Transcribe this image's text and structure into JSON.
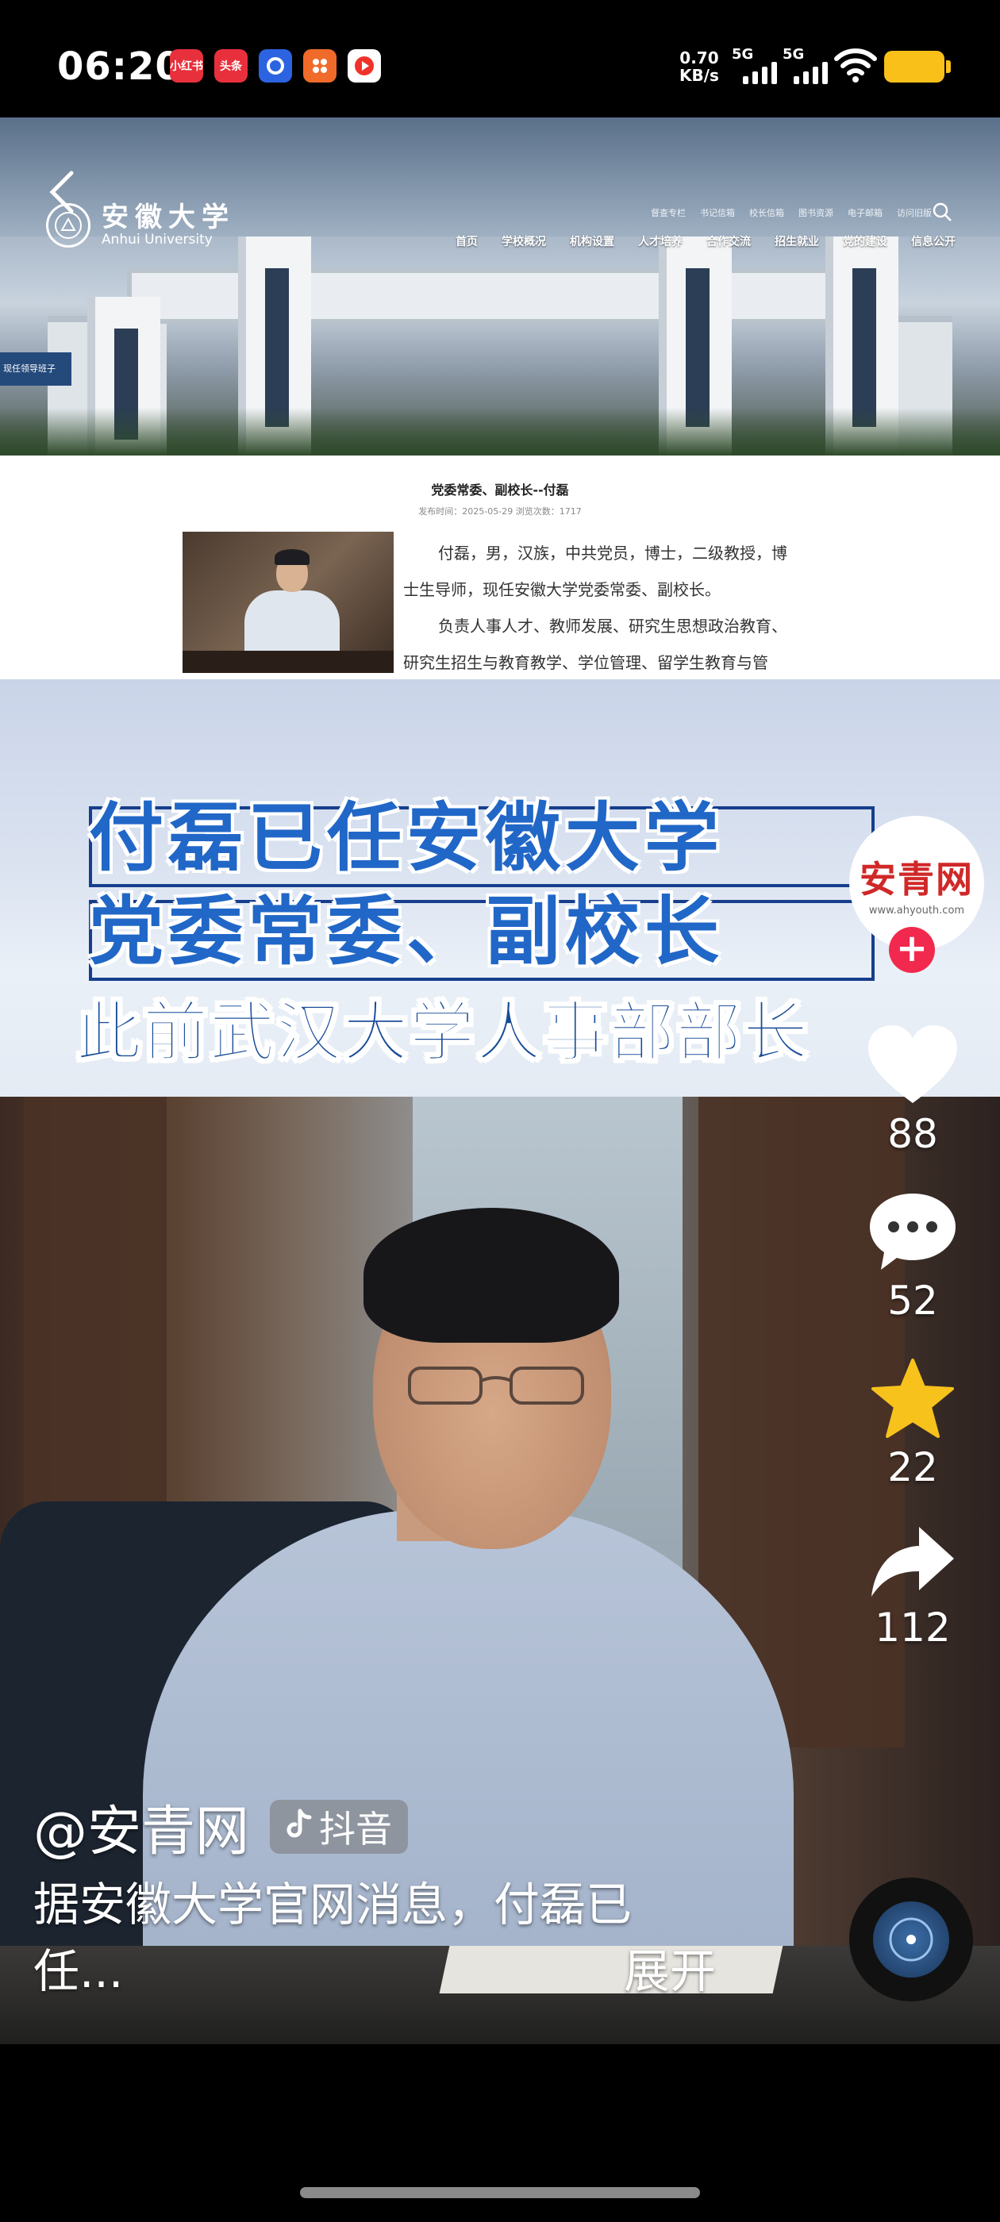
{
  "status_bar": {
    "time": "06:20",
    "notification_apps": [
      {
        "label": "小红书",
        "color": "#e8303c"
      },
      {
        "label": "头条",
        "color": "#e8303c"
      },
      {
        "label": "",
        "color": "#2c63e0"
      },
      {
        "label": "",
        "color": "#f06a2a"
      },
      {
        "label": "",
        "color": "#fff"
      }
    ],
    "net_speed_value": "0.70",
    "net_speed_unit": "KB/s",
    "sim1_label": "5G",
    "sim2_label": "5G",
    "battery_color": "#f9c01a"
  },
  "website": {
    "university_name_cn": "安徽大学",
    "university_name_en": "Anhui University",
    "top_links": [
      "督查专栏",
      "书记信箱",
      "校长信箱",
      "图书资源",
      "电子邮箱",
      "访问旧版"
    ],
    "nav_items": [
      "首页",
      "学校概况",
      "机构设置",
      "人才培养",
      "合作交流",
      "招生就业",
      "党的建设",
      "信息公开"
    ],
    "left_tag": "现任领导班子",
    "article_title": "党委常委、副校长--付磊",
    "article_meta": "发布时间：2025-05-29  浏览次数：1717",
    "article_paragraphs": [
      "付磊，男，汉族，中共党员，博士，二级教授，博",
      "士生导师，现任安徽大学党委常委、副校长。",
      "负责人事人才、教师发展、研究生思想政治教育、",
      "研究生招生与教育教学、学位管理、留学生教育与管"
    ]
  },
  "banner": {
    "headline_line1": "付磊已任安徽大学",
    "headline_line2": "党委常委、副校长",
    "subheadline": "此前武汉大学人事部部长",
    "watermark_title": "安青网",
    "watermark_url": "www.ahyouth.com",
    "headline_color": "#2167c7",
    "subheadline_color": "#184c98"
  },
  "actions": {
    "like_count": "88",
    "comment_count": "52",
    "favorite_count": "22",
    "share_count": "112",
    "follow_plus": "+",
    "favorite_color": "#f7c21c",
    "follow_color": "#f2294e"
  },
  "post": {
    "author": "@安青网",
    "platform_tag": "抖音",
    "caption_line1": "据安徽大学官网消息，付磊已",
    "caption_line2": "任...",
    "expand_label": "展开"
  }
}
